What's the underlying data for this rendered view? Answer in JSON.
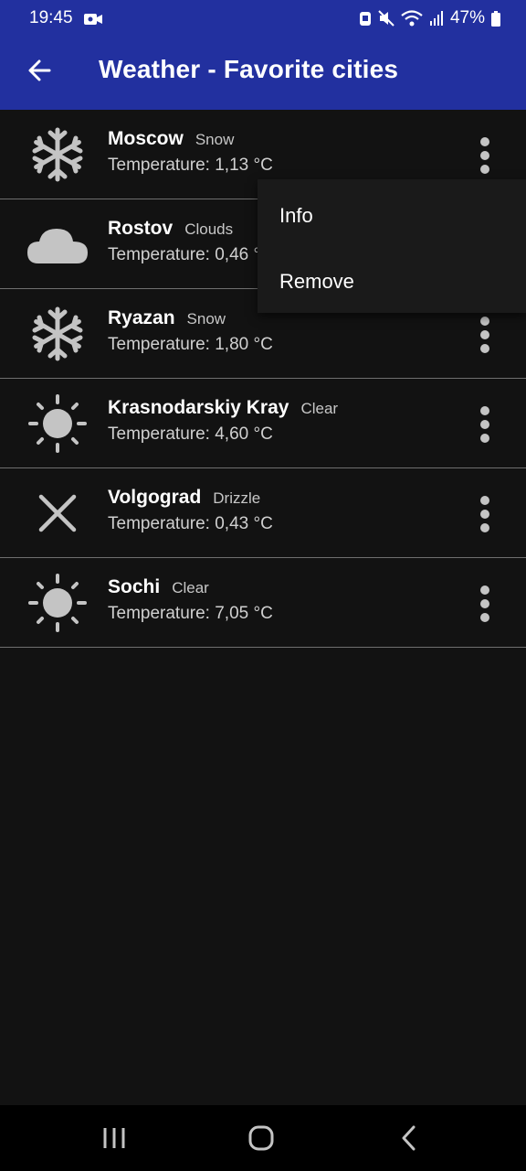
{
  "status_bar": {
    "time": "19:45",
    "battery": "47%"
  },
  "app_bar": {
    "title": "Weather - Favorite cities",
    "back_icon": "arrow-back-icon"
  },
  "cities": [
    {
      "name": "Moscow",
      "condition": "Snow",
      "temperature": "Temperature: 1,13 °C",
      "icon": "snow-icon"
    },
    {
      "name": "Rostov",
      "condition": "Clouds",
      "temperature": "Temperature: 0,46 °C",
      "icon": "cloud-icon"
    },
    {
      "name": "Ryazan",
      "condition": "Snow",
      "temperature": "Temperature: 1,80 °C",
      "icon": "snow-icon"
    },
    {
      "name": "Krasnodarskiy Kray",
      "condition": "Clear",
      "temperature": "Temperature: 4,60 °C",
      "icon": "sun-icon"
    },
    {
      "name": "Volgograd",
      "condition": "Drizzle",
      "temperature": "Temperature: 0,43 °C",
      "icon": "cross-icon"
    },
    {
      "name": "Sochi",
      "condition": "Clear",
      "temperature": "Temperature: 7,05 °C",
      "icon": "sun-icon"
    }
  ],
  "popup_menu": {
    "items": [
      "Info",
      "Remove"
    ]
  },
  "colors": {
    "app_bar": "#22309f",
    "background": "#121212",
    "icon_gray": "#c4c4c4"
  }
}
